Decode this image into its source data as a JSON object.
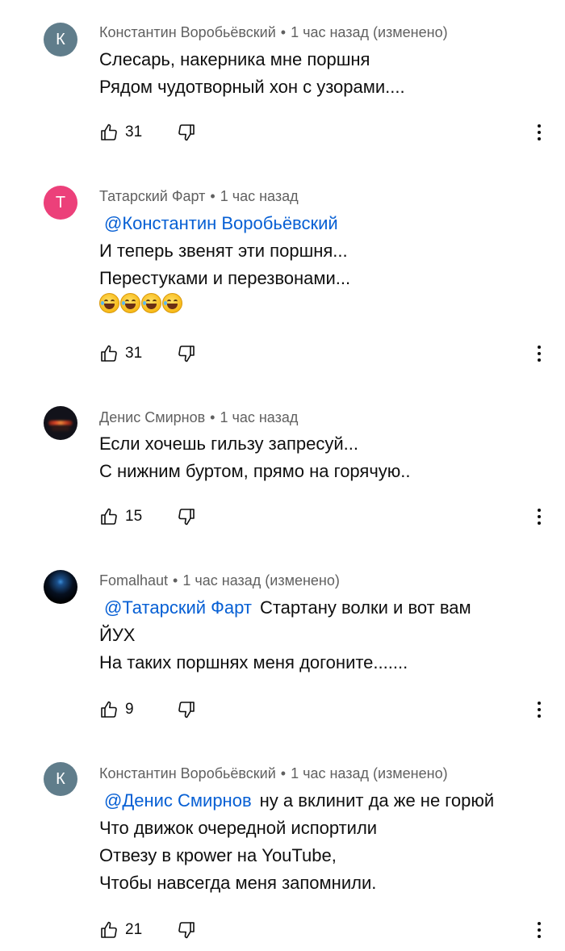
{
  "comments": [
    {
      "author": "Константин Воробьёвский",
      "time": "1 час назад (изменено)",
      "avatar_letter": "К",
      "mention": "",
      "lines": [
        "Слесарь, накерника мне поршня",
        "Рядом чудотворный хон с узорами...."
      ],
      "likes": "31"
    },
    {
      "author": "Татарский Фарт",
      "time": "1 час назад",
      "avatar_letter": "Т",
      "mention": "@Константин Воробьёвский",
      "lines": [
        "И теперь звенят эти поршня...",
        "Перестуками и перезвонами..."
      ],
      "likes": "31"
    },
    {
      "author": "Денис Смирнов",
      "time": "1 час назад",
      "avatar_letter": "",
      "mention": "",
      "lines": [
        "Если хочешь гильзу запресуй...",
        "С нижним буртом, прямо на горячую.."
      ],
      "likes": "15"
    },
    {
      "author": "Fomalhaut",
      "time": "1 час назад (изменено)",
      "avatar_letter": "",
      "mention": "@Татарский Фарт",
      "mention_tail": "Стартану волки и вот вам",
      "lines": [
        "ЙУХ",
        "На таких поршнях меня догоните......."
      ],
      "likes": "9"
    },
    {
      "author": "Константин Воробьёвский",
      "time": "1 час назад (изменено)",
      "avatar_letter": "К",
      "mention": "@Денис Смирнов",
      "mention_tail": "ну а вклинит да же не горюй",
      "lines": [
        "Что движок очередной испортили",
        "Отвезу в кроwer на YouTube,",
        "Чтобы навсегда меня запомнили."
      ],
      "likes": "21"
    }
  ],
  "separator": "•",
  "emoji_name": "grinning-squinting-face-emoji",
  "icons": {
    "like": "thumbs-up-icon",
    "dislike": "thumbs-down-icon",
    "more": "more-vertical-icon"
  },
  "colors": {
    "text": "#0f0f0f",
    "meta": "#606060",
    "mention": "#065fd4",
    "avatar_grey": "#607d8b",
    "avatar_pink": "#ec407a"
  }
}
